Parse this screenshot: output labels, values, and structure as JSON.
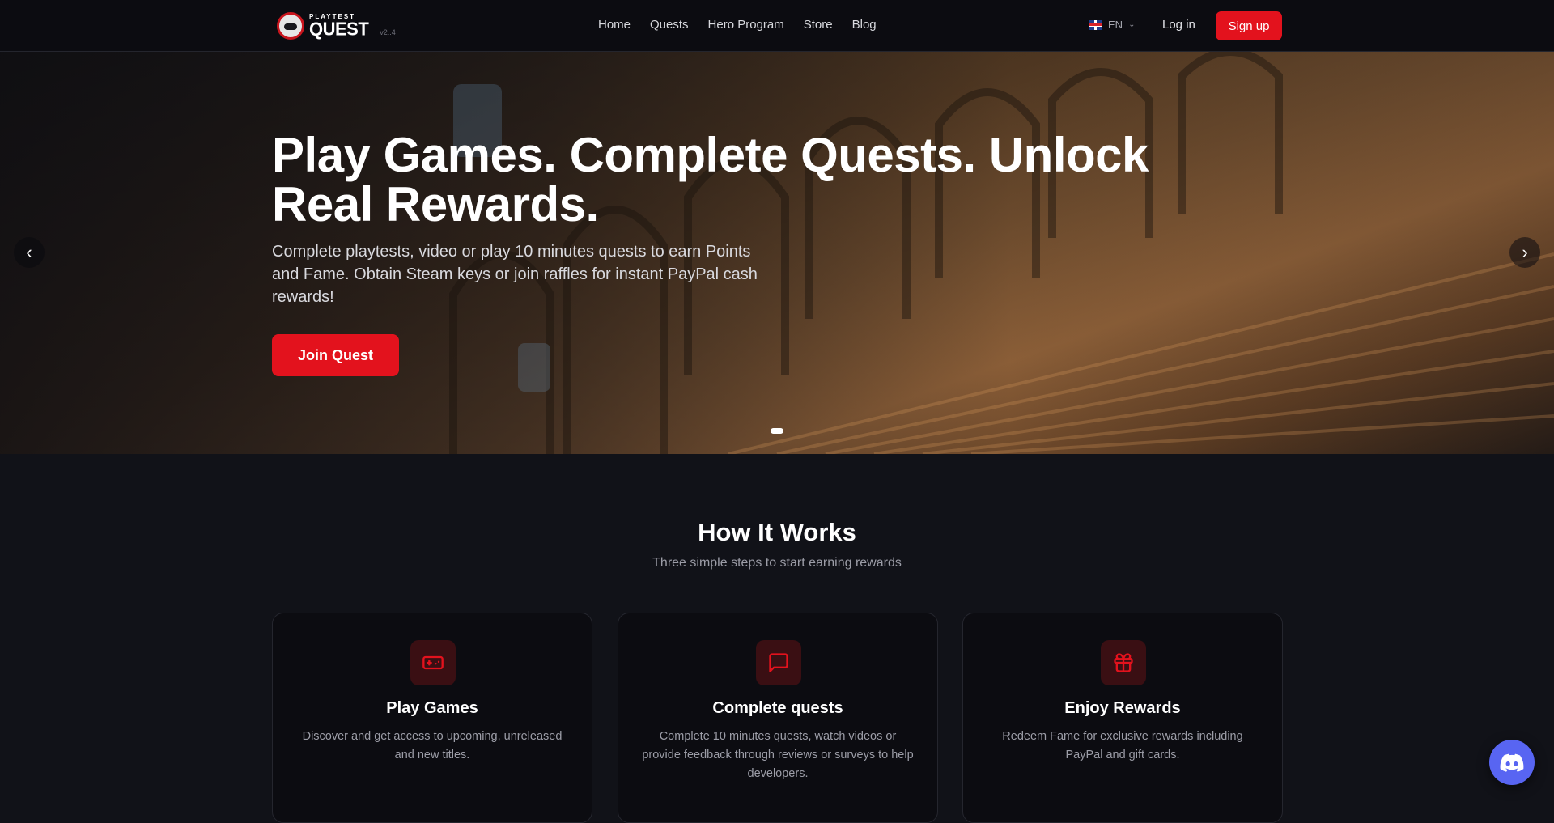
{
  "header": {
    "logo_small": "PLAYTEST",
    "logo_big": "QUEST",
    "version": "v2..4",
    "nav": [
      "Home",
      "Quests",
      "Hero Program",
      "Store",
      "Blog"
    ],
    "language": "EN",
    "login_label": "Log in",
    "signup_label": "Sign up"
  },
  "hero": {
    "title": "Play Games. Complete Quests. Unlock Real Rewards.",
    "subtitle": "Complete playtests, video or play 10 minutes quests to earn Points and Fame. Obtain Steam keys or join raffles for instant PayPal cash rewards!",
    "cta_label": "Join Quest",
    "prev_icon": "chevron-left-icon",
    "next_icon": "chevron-right-icon"
  },
  "how_it_works": {
    "title": "How It Works",
    "subtitle": "Three simple steps to start earning rewards",
    "cards": [
      {
        "icon": "gamepad-icon",
        "title": "Play Games",
        "description": "Discover and get access to upcoming, unreleased and new titles."
      },
      {
        "icon": "message-icon",
        "title": "Complete quests",
        "description": "Complete 10 minutes quests, watch videos or provide feedback through reviews or surveys to help developers."
      },
      {
        "icon": "gift-icon",
        "title": "Enjoy Rewards",
        "description": "Redeem Fame for exclusive rewards including PayPal and gift cards."
      }
    ]
  },
  "colors": {
    "accent": "#e3121d",
    "background": "#111218",
    "card": "#0c0c11",
    "discord": "#5865f2"
  }
}
